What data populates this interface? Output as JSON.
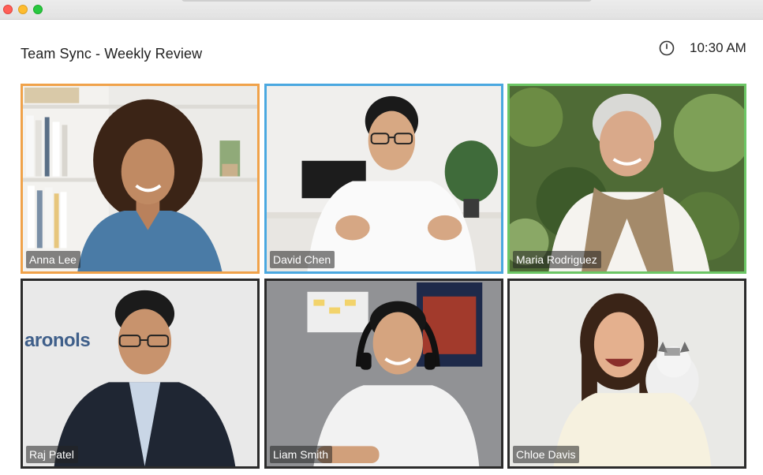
{
  "window": {
    "title": ""
  },
  "header": {
    "meeting_title": "Team Sync - Weekly Review",
    "time": "10:30 AM",
    "clock_icon": "clock-icon"
  },
  "participants": [
    {
      "name": "Anna Lee",
      "highlight_color": "#f0a24a"
    },
    {
      "name": "David Chen",
      "highlight_color": "#4aa8e0"
    },
    {
      "name": "Maria Rodriguez",
      "highlight_color": "#6cc665"
    },
    {
      "name": "Raj Patel",
      "highlight_color": ""
    },
    {
      "name": "Liam Smith",
      "highlight_color": ""
    },
    {
      "name": "Chloe Davis",
      "highlight_color": ""
    }
  ],
  "tile_4_backdrop_text": "aronols"
}
